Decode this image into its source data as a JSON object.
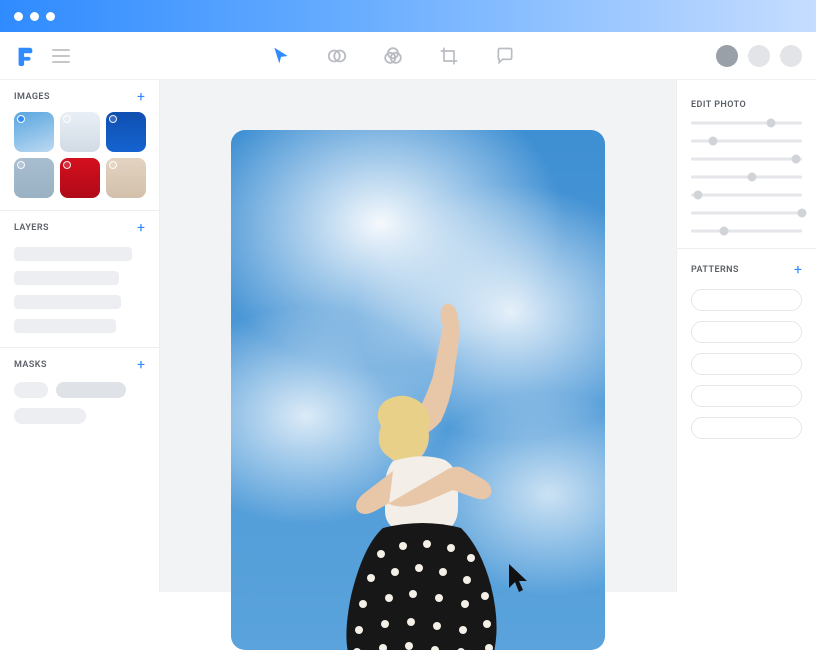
{
  "toolbar": {
    "tools": [
      "cursor-icon",
      "blend-icon",
      "overlap-icon",
      "crop-icon",
      "chat-icon"
    ]
  },
  "left": {
    "images": {
      "title": "IMAGES",
      "thumbs": [
        {
          "name": "thumb-1",
          "selected": true
        },
        {
          "name": "thumb-2",
          "selected": false
        },
        {
          "name": "thumb-3",
          "selected": false
        },
        {
          "name": "thumb-4",
          "selected": false
        },
        {
          "name": "thumb-5",
          "selected": false
        },
        {
          "name": "thumb-6",
          "selected": false
        }
      ]
    },
    "layers": {
      "title": "LAYERS"
    },
    "masks": {
      "title": "MASKS"
    }
  },
  "right": {
    "edit": {
      "title": "EDIT PHOTO",
      "sliders": [
        72,
        20,
        95,
        55,
        6,
        100,
        30
      ]
    },
    "patterns": {
      "title": "PATTERNS",
      "slots": 5
    },
    "add": "+"
  },
  "add_symbol": "+"
}
